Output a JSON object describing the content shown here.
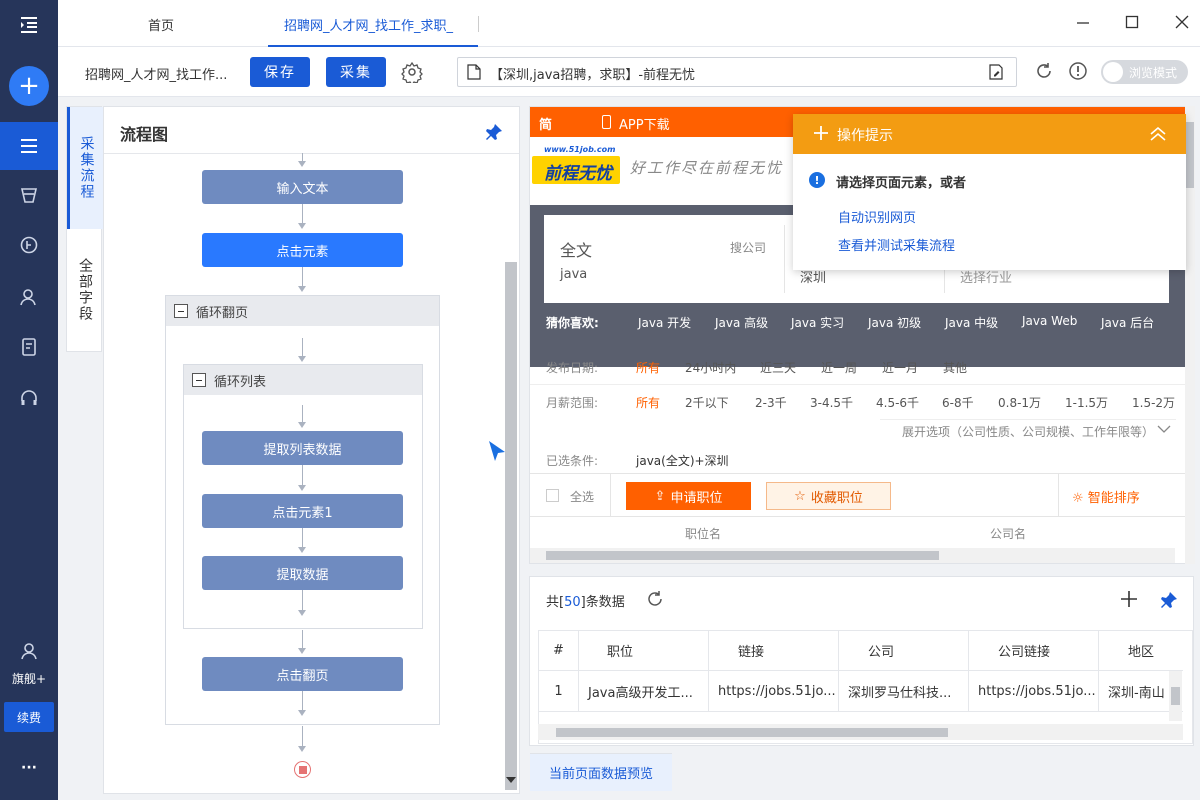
{
  "sidebar": {
    "plan_label": "旗舰+",
    "renew_label": "续费",
    "more_label": "···"
  },
  "tabs": {
    "home": "首页",
    "active": "招聘网_人才网_找工作_求职_"
  },
  "toolbar": {
    "task_name": "招聘网_人才网_找工作...",
    "save_label": "保存",
    "collect_label": "采集",
    "url_text": "【深圳,java招聘，求职】-前程无忧",
    "browse_mode": "浏览模式"
  },
  "left_tabs": {
    "flow": "采集流程",
    "fields": "全部字段"
  },
  "flow": {
    "title": "流程图",
    "input_text": "输入文本",
    "click_element": "点击元素",
    "loop_page": "循环翻页",
    "loop_list": "循环列表",
    "extract_list": "提取列表数据",
    "click_element1": "点击元素1",
    "extract_data": "提取数据",
    "click_next": "点击翻页"
  },
  "site": {
    "top_label": "简",
    "app_download": "APP下载",
    "logo_url": "www.51job.com",
    "logo_text": "前程无忧",
    "slogan": "好工作尽在前程无忧",
    "search_value": "全文",
    "search_sub": "java",
    "search_company": "搜公司",
    "city": "深圳",
    "industry": "选择行业",
    "guess_label": "猜你喜欢:",
    "guess_items": [
      "Java 开发",
      "Java 高级",
      "Java 实习",
      "Java 初级",
      "Java 中级",
      "Java Web",
      "Java 后台"
    ],
    "date_label": "发布日期:",
    "date_items": [
      "所有",
      "24小时内",
      "近三天",
      "近一周",
      "近一月",
      "其他"
    ],
    "salary_label": "月薪范围:",
    "salary_items": [
      "所有",
      "2千以下",
      "2-3千",
      "3-4.5千",
      "4.5-6千",
      "6-8千",
      "0.8-1万",
      "1-1.5万",
      "1.5-2万"
    ],
    "expand": "展开选项（公司性质、公司规模、工作年限等）",
    "selected_label": "已选条件:",
    "selected_value": "java(全文)+深圳",
    "select_all": "全选",
    "apply": "申请职位",
    "favorite": "收藏职位",
    "smart_sort": "智能排序",
    "col_position": "职位名",
    "col_company": "公司名"
  },
  "tips": {
    "title": "操作提示",
    "message": "请选择页面元素，或者",
    "link1": "自动识别网页",
    "link2": "查看并测试采集流程"
  },
  "data_panel": {
    "count_prefix": "共[",
    "count": "50",
    "count_suffix": "]条数据",
    "headers": [
      "#",
      "职位",
      "链接",
      "公司",
      "公司链接",
      "地区"
    ],
    "row1": [
      "1",
      "Java高级开发工...",
      "https://jobs.51jo...",
      "深圳罗马仕科技...",
      "https://jobs.51jo...",
      "深圳-南山"
    ],
    "preview_tab": "当前页面数据预览"
  },
  "colors": {
    "sidebar": "#26355a",
    "primary": "#1a5bd6",
    "node": "#6f8bc0",
    "node_active": "#2979ff",
    "site_orange": "#ff6000",
    "tips_orange": "#f39c12"
  }
}
